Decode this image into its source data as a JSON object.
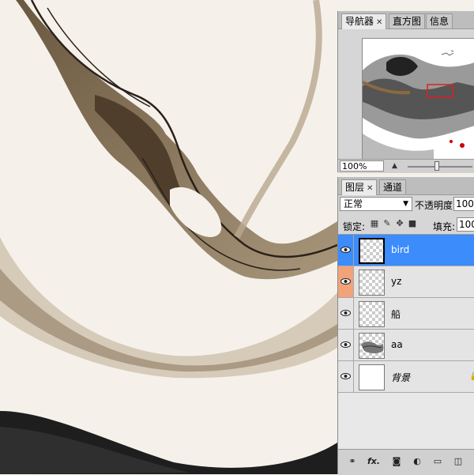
{
  "navigator": {
    "tabs": [
      "导航器",
      "直方图",
      "信息"
    ],
    "zoom": "100%",
    "zoom_slider": 0.45
  },
  "layers_panel": {
    "tabs": [
      "图层",
      "通道"
    ],
    "blend_mode": "正常",
    "opacity_label": "不透明度:",
    "opacity_value": "100",
    "lock_label": "锁定:",
    "fill_label": "填充:",
    "fill_value": "100",
    "layers": [
      {
        "name": "bird",
        "selected": true,
        "eye_highlight": false,
        "thumb": "transparent"
      },
      {
        "name": "yz",
        "selected": false,
        "eye_highlight": true,
        "thumb": "transparent"
      },
      {
        "name": "船",
        "selected": false,
        "eye_highlight": false,
        "thumb": "transparent"
      },
      {
        "name": "aa",
        "selected": false,
        "eye_highlight": false,
        "thumb": "ink"
      },
      {
        "name": "背景",
        "selected": false,
        "eye_highlight": false,
        "thumb": "white"
      }
    ]
  },
  "colors": {
    "selection": "#3c8cfc",
    "eye_highlight": "#f2a37a",
    "ink": "#5a4632",
    "paper": "#f5f1ea"
  }
}
